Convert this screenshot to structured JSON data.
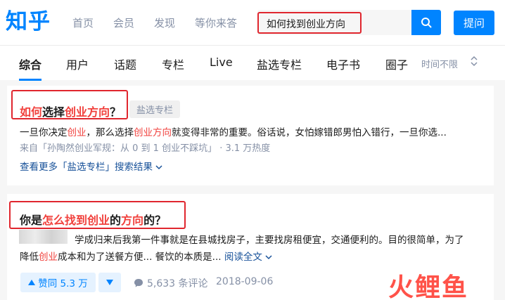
{
  "header": {
    "logo": "知乎",
    "nav": [
      "首页",
      "会员",
      "发现",
      "等你来答"
    ],
    "search_value": "如何找到创业方向",
    "ask_label": "提问"
  },
  "tabs": {
    "items": [
      "综合",
      "用户",
      "话题",
      "专栏",
      "Live",
      "盐选专栏",
      "电子书",
      "圈子"
    ],
    "active_index": 0,
    "time_filter": "时间不限"
  },
  "results": [
    {
      "title_parts": [
        {
          "text": "如何",
          "hl": true
        },
        {
          "text": "选择",
          "hl": false
        },
        {
          "text": "创业方向",
          "hl": true
        },
        {
          "text": "？",
          "hl": false
        }
      ],
      "tag": "盐选专栏",
      "excerpt_parts": [
        {
          "text": "一旦你决定",
          "hl": false
        },
        {
          "text": "创业",
          "hl": true
        },
        {
          "text": "，那么选择",
          "hl": false
        },
        {
          "text": "创业方向",
          "hl": true
        },
        {
          "text": "就变得非常的重要。俗话说，女怕嫁错郎男怕入错行，一旦你选...",
          "hl": false
        }
      ],
      "source": "来自「孙陶然创业军规：从 0 到 1 创业不踩坑」 · 3.1 万热度",
      "more_label": "查看更多「盐选专栏」搜索结果"
    },
    {
      "title_parts": [
        {
          "text": "你是",
          "hl": false
        },
        {
          "text": "怎么找到创业",
          "hl": true
        },
        {
          "text": "的",
          "hl": false
        },
        {
          "text": "方向",
          "hl": true
        },
        {
          "text": "的？",
          "hl": false
        }
      ],
      "excerpt_line1": "学成归来后我第一件事就是在县城找房子，主要找房租便宜，交通便利的。目的很简单，为了",
      "excerpt_line2_parts": [
        {
          "text": "降低",
          "hl": false
        },
        {
          "text": "创业",
          "hl": true
        },
        {
          "text": "成本和为了送餐方便... 餐饮的本质是...",
          "hl": false
        }
      ],
      "read_more": "阅读全文",
      "vote_label": "赞同 5.3 万",
      "comments_label": "5,633 条评论",
      "date": "2018-09-06"
    }
  ],
  "watermark": "火鲤鱼",
  "colors": {
    "brand": "#0084ff",
    "highlight": "#f1403c",
    "annotation": "#e0262e"
  }
}
